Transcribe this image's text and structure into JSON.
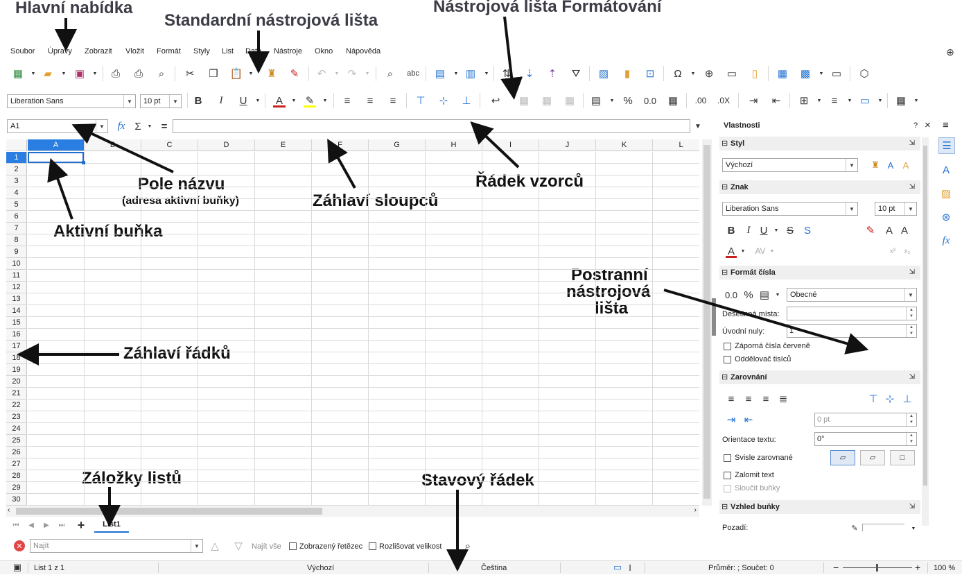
{
  "annotations": {
    "main_menu": "Hlavní nabídka",
    "standard_toolbar": "Standardní nástrojová lišta",
    "formatting_toolbar": "Nástrojová lišta Formátování",
    "name_box_1": "Pole názvu",
    "name_box_2": "(adresa aktivní buňky)",
    "formula_bar": "Řádek vzorců",
    "active_cell": "Aktivní buňka",
    "column_headers": "Záhlaví sloupců",
    "sidebar_1": "Postranní",
    "sidebar_2": "nástrojová",
    "sidebar_3": "lišta",
    "row_headers": "Záhlaví řádků",
    "sheet_tabs": "Záložky listů",
    "status_bar": "Stavový řádek"
  },
  "menu": [
    "Soubor",
    "Úpravy",
    "Zobrazit",
    "Vložit",
    "Formát",
    "Styly",
    "List",
    "Data",
    "Nástroje",
    "Okno",
    "Nápověda"
  ],
  "formatting": {
    "font_name": "Liberation Sans",
    "font_size": "10 pt",
    "bold": "B",
    "italic": "I",
    "underline": "U",
    "percent": "%",
    "number_format_0_0": "0.0",
    "add_decimal": ".00",
    "delete_decimal": ".0X"
  },
  "formula_bar": {
    "name_box": "A1",
    "fx": "fx",
    "sum": "Σ",
    "equals": "="
  },
  "grid": {
    "columns": [
      "A",
      "B",
      "C",
      "D",
      "E",
      "F",
      "G",
      "H",
      "I",
      "J",
      "K",
      "L"
    ],
    "rows": [
      "1",
      "2",
      "3",
      "4",
      "5",
      "6",
      "7",
      "8",
      "9",
      "10",
      "11",
      "12",
      "13",
      "14",
      "15",
      "16",
      "17",
      "18",
      "19",
      "20",
      "21",
      "22",
      "23",
      "24",
      "25",
      "26",
      "27",
      "28",
      "29",
      "30"
    ],
    "active_column": "A",
    "active_row": "1"
  },
  "sheet_tabs": {
    "add": "+",
    "tabs": [
      "List1"
    ]
  },
  "find_bar": {
    "placeholder": "Najít",
    "find_all": "Najít vše",
    "formatted_display": "Zobrazený řetězec",
    "match_case": "Rozlišovat velikost"
  },
  "sidebar": {
    "title": "Vlastnosti",
    "help": "?",
    "close": "×",
    "menu": "≡",
    "style_section": "Styl",
    "style_value": "Výchozí",
    "char_section": "Znak",
    "char_font": "Liberation Sans",
    "char_size": "10 pt",
    "numfmt_section": "Formát čísla",
    "numfmt_value": "Obecné",
    "decimal_places": "Desetinná místa:",
    "leading_zeros": "Úvodní nuly:",
    "leading_zeros_value": "1",
    "negative_red": "Záporná čísla červeně",
    "thousands_sep": "Oddělovač tisíců",
    "align_section": "Zarovnání",
    "indent_value": "0 pt",
    "text_orientation": "Orientace textu:",
    "orientation_value": "0°",
    "vertically_stacked": "Svisle zarovnané",
    "wrap_text": "Zalomit text",
    "merge_cells": "Sloučit buňky",
    "appearance_section": "Vzhled buňky",
    "background": "Pozadí:"
  },
  "status": {
    "sheet": "List 1 z 1",
    "page_style": "Výchozí",
    "language": "Čeština",
    "sum_text": "Průměr: ; Součet: 0",
    "zoom": "100 %",
    "zoom_minus": "−",
    "zoom_plus": "+"
  },
  "colors": {
    "accent": "#1f6fd1",
    "active_header": "#2a7de1",
    "font_color": "#c9211e",
    "highlight": "#ffff00",
    "find_close": "#e04545"
  }
}
